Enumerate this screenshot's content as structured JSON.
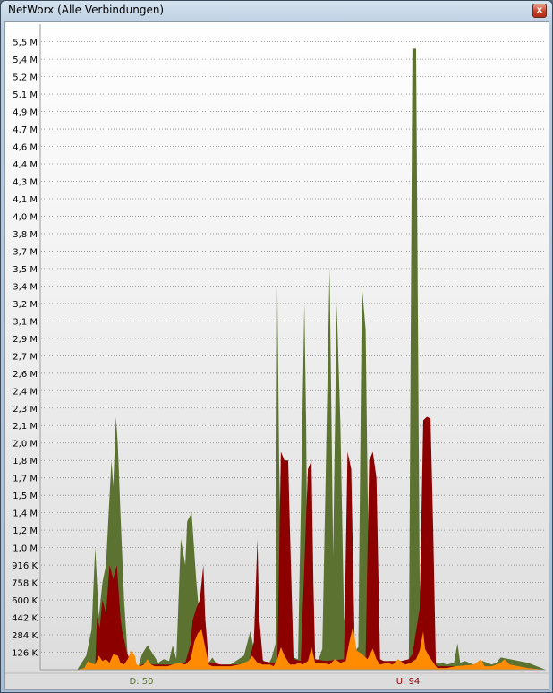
{
  "window": {
    "title": "NetWorx (Alle Verbindungen)",
    "close_label": "x"
  },
  "colors": {
    "download": "#5b7231",
    "upload": "#8c0000",
    "local": "#ff8c00",
    "grid": "#888888"
  },
  "chart_data": {
    "type": "area",
    "title": "",
    "ylabel": "",
    "xlabel": "",
    "y_ticks": [
      "126 K",
      "284 K",
      "442 K",
      "600 K",
      "758 K",
      "916 K",
      "1,0 M",
      "1,2 M",
      "1,4 M",
      "1,5 M",
      "1,7 M",
      "1,8 M",
      "2,0 M",
      "2,1 M",
      "2,3 M",
      "2,4 M",
      "2,6 M",
      "2,7 M",
      "2,9 M",
      "3,1 M",
      "3,2 M",
      "3,4 M",
      "3,5 M",
      "3,7 M",
      "3,8 M",
      "4,0 M",
      "4,1 M",
      "4,3 M",
      "4,4 M",
      "4,6 M",
      "4,7 M",
      "4,9 M",
      "5,1 M",
      "5,2 M",
      "5,4 M",
      "5,5 M"
    ],
    "ylim_index": [
      0,
      35.7
    ],
    "legend": {
      "download_label": "D: 50",
      "upload_label": "U: 94"
    },
    "series": [
      {
        "name": "D",
        "color_key": "download",
        "points": [
          [
            0,
            0
          ],
          [
            40,
            0
          ],
          [
            50,
            0.8
          ],
          [
            56,
            2.3
          ],
          [
            60,
            7
          ],
          [
            64,
            3
          ],
          [
            68,
            5
          ],
          [
            72,
            6
          ],
          [
            75,
            9
          ],
          [
            78,
            12
          ],
          [
            80,
            10.5
          ],
          [
            83,
            14.5
          ],
          [
            85,
            13
          ],
          [
            88,
            9
          ],
          [
            92,
            4
          ],
          [
            96,
            0.8
          ],
          [
            100,
            0.3
          ],
          [
            108,
            0.2
          ],
          [
            112,
            0.9
          ],
          [
            118,
            1.4
          ],
          [
            124,
            0.9
          ],
          [
            130,
            0.4
          ],
          [
            136,
            0.6
          ],
          [
            142,
            0.5
          ],
          [
            146,
            1.4
          ],
          [
            150,
            0.6
          ],
          [
            155,
            7.5
          ],
          [
            160,
            6
          ],
          [
            162,
            8.5
          ],
          [
            167,
            9
          ],
          [
            172,
            5.2
          ],
          [
            176,
            2.8
          ],
          [
            180,
            0.6
          ],
          [
            186,
            0.4
          ],
          [
            190,
            0.7
          ],
          [
            195,
            0.3
          ],
          [
            210,
            0.3
          ],
          [
            225,
            0.8
          ],
          [
            232,
            2.2
          ],
          [
            236,
            1.2
          ],
          [
            240,
            1.5
          ],
          [
            245,
            0.6
          ],
          [
            252,
            0.3
          ],
          [
            256,
            0.7
          ],
          [
            260,
            1.5
          ],
          [
            262,
            22
          ],
          [
            264,
            12
          ],
          [
            268,
            0.8
          ],
          [
            272,
            0.5
          ],
          [
            280,
            0.7
          ],
          [
            285,
            0.6
          ],
          [
            288,
            9
          ],
          [
            292,
            21
          ],
          [
            294,
            14
          ],
          [
            296,
            1.2
          ],
          [
            300,
            0.4
          ],
          [
            308,
            0.6
          ],
          [
            312,
            1.2
          ],
          [
            316,
            12
          ],
          [
            320,
            23
          ],
          [
            324,
            6.5
          ],
          [
            328,
            21
          ],
          [
            332,
            14
          ],
          [
            336,
            3
          ],
          [
            340,
            1.7
          ],
          [
            345,
            0.9
          ],
          [
            352,
            1.3
          ],
          [
            356,
            22
          ],
          [
            360,
            19.5
          ],
          [
            364,
            3
          ],
          [
            368,
            0.9
          ],
          [
            372,
            0.6
          ],
          [
            380,
            0.5
          ],
          [
            390,
            0.4
          ],
          [
            400,
            0.3
          ],
          [
            408,
            0.5
          ],
          [
            412,
            35.6
          ],
          [
            416,
            35.6
          ],
          [
            420,
            5
          ],
          [
            424,
            0.9
          ],
          [
            430,
            0.5
          ],
          [
            436,
            0.4
          ],
          [
            445,
            0.4
          ],
          [
            450,
            0.3
          ],
          [
            458,
            0.4
          ],
          [
            462,
            1.5
          ],
          [
            465,
            0.4
          ],
          [
            470,
            0.5
          ],
          [
            480,
            0.3
          ],
          [
            490,
            0.5
          ],
          [
            500,
            0.3
          ],
          [
            505,
            0.4
          ],
          [
            510,
            0.7
          ],
          [
            520,
            0.6
          ],
          [
            540,
            0.4
          ],
          [
            560,
            0
          ]
        ]
      },
      {
        "name": "U",
        "color_key": "upload",
        "points": [
          [
            0,
            0
          ],
          [
            40,
            0
          ],
          [
            60,
            0.1
          ],
          [
            62,
            3
          ],
          [
            65,
            2.4
          ],
          [
            68,
            4
          ],
          [
            72,
            3.2
          ],
          [
            76,
            6
          ],
          [
            80,
            5.2
          ],
          [
            84,
            6
          ],
          [
            88,
            3
          ],
          [
            90,
            2.2
          ],
          [
            95,
            1
          ],
          [
            100,
            0.4
          ],
          [
            108,
            0.2
          ],
          [
            112,
            0.3
          ],
          [
            118,
            0.4
          ],
          [
            124,
            0.3
          ],
          [
            130,
            0.3
          ],
          [
            136,
            0.3
          ],
          [
            142,
            0.3
          ],
          [
            150,
            0.3
          ],
          [
            160,
            0.4
          ],
          [
            166,
            1.5
          ],
          [
            168,
            2.8
          ],
          [
            172,
            3.5
          ],
          [
            176,
            4
          ],
          [
            180,
            6
          ],
          [
            182,
            3
          ],
          [
            186,
            0.4
          ],
          [
            190,
            0.4
          ],
          [
            200,
            0.3
          ],
          [
            230,
            0.3
          ],
          [
            236,
            1.6
          ],
          [
            240,
            7.5
          ],
          [
            242,
            3
          ],
          [
            246,
            0.5
          ],
          [
            256,
            0.4
          ],
          [
            262,
            0.4
          ],
          [
            266,
            12.5
          ],
          [
            270,
            12
          ],
          [
            274,
            12
          ],
          [
            276,
            8
          ],
          [
            280,
            0.6
          ],
          [
            288,
            0.5
          ],
          [
            296,
            11.5
          ],
          [
            300,
            12
          ],
          [
            302,
            5
          ],
          [
            304,
            0.6
          ],
          [
            316,
            0.5
          ],
          [
            336,
            0.6
          ],
          [
            340,
            12.5
          ],
          [
            344,
            11.5
          ],
          [
            348,
            1
          ],
          [
            352,
            0.6
          ],
          [
            360,
            0.7
          ],
          [
            364,
            12
          ],
          [
            368,
            12.5
          ],
          [
            372,
            11
          ],
          [
            376,
            0.6
          ],
          [
            380,
            0.5
          ],
          [
            400,
            0.5
          ],
          [
            408,
            0.6
          ],
          [
            412,
            0.9
          ],
          [
            420,
            3.5
          ],
          [
            424,
            14.3
          ],
          [
            428,
            14.5
          ],
          [
            432,
            14.4
          ],
          [
            435,
            8
          ],
          [
            438,
            0.3
          ],
          [
            440,
            0.2
          ],
          [
            450,
            0.2
          ],
          [
            470,
            0.2
          ],
          [
            480,
            0.2
          ],
          [
            490,
            0.2
          ],
          [
            500,
            0.2
          ],
          [
            510,
            0.2
          ],
          [
            540,
            0.1
          ],
          [
            560,
            0
          ]
        ]
      },
      {
        "name": "L",
        "color_key": "local",
        "points": [
          [
            0,
            0
          ],
          [
            40,
            0
          ],
          [
            48,
            0.1
          ],
          [
            52,
            0.5
          ],
          [
            55,
            0.4
          ],
          [
            60,
            0.3
          ],
          [
            64,
            0.8
          ],
          [
            68,
            0.5
          ],
          [
            72,
            0.6
          ],
          [
            76,
            0.4
          ],
          [
            80,
            0.9
          ],
          [
            85,
            0.8
          ],
          [
            88,
            0.4
          ],
          [
            92,
            0.3
          ],
          [
            96,
            0.6
          ],
          [
            100,
            1.1
          ],
          [
            104,
            0.8
          ],
          [
            106,
            0.3
          ],
          [
            110,
            0.2
          ],
          [
            114,
            0.3
          ],
          [
            118,
            0.6
          ],
          [
            122,
            0.3
          ],
          [
            126,
            0.2
          ],
          [
            140,
            0.2
          ],
          [
            146,
            0.3
          ],
          [
            152,
            0.4
          ],
          [
            160,
            0.3
          ],
          [
            166,
            0.6
          ],
          [
            170,
            1.6
          ],
          [
            174,
            2.1
          ],
          [
            178,
            2.3
          ],
          [
            182,
            1.3
          ],
          [
            186,
            0.3
          ],
          [
            190,
            0.2
          ],
          [
            210,
            0.2
          ],
          [
            220,
            0.3
          ],
          [
            230,
            0.5
          ],
          [
            234,
            0.8
          ],
          [
            240,
            0.4
          ],
          [
            246,
            0.3
          ],
          [
            254,
            0.3
          ],
          [
            258,
            0.2
          ],
          [
            262,
            0.6
          ],
          [
            266,
            1.3
          ],
          [
            270,
            0.8
          ],
          [
            276,
            0.3
          ],
          [
            282,
            0.3
          ],
          [
            286,
            0.4
          ],
          [
            290,
            0.3
          ],
          [
            296,
            0.5
          ],
          [
            300,
            1.3
          ],
          [
            304,
            0.4
          ],
          [
            312,
            0.4
          ],
          [
            320,
            0.3
          ],
          [
            326,
            0.6
          ],
          [
            332,
            0.4
          ],
          [
            338,
            0.5
          ],
          [
            342,
            1.6
          ],
          [
            346,
            2.5
          ],
          [
            350,
            1.1
          ],
          [
            356,
            0.9
          ],
          [
            362,
            0.6
          ],
          [
            368,
            1.2
          ],
          [
            372,
            0.6
          ],
          [
            376,
            0.3
          ],
          [
            384,
            0.4
          ],
          [
            390,
            0.3
          ],
          [
            396,
            0.6
          ],
          [
            404,
            0.3
          ],
          [
            410,
            0.4
          ],
          [
            416,
            0.6
          ],
          [
            420,
            1.1
          ],
          [
            424,
            2.2
          ],
          [
            426,
            1.2
          ],
          [
            430,
            0.8
          ],
          [
            434,
            0.5
          ],
          [
            438,
            0.2
          ],
          [
            440,
            0.1
          ],
          [
            450,
            0.1
          ],
          [
            460,
            0.2
          ],
          [
            480,
            0.3
          ],
          [
            488,
            0.6
          ],
          [
            492,
            0.2
          ],
          [
            500,
            0.2
          ],
          [
            510,
            0.4
          ],
          [
            514,
            0.6
          ],
          [
            520,
            0.3
          ],
          [
            540,
            0.1
          ],
          [
            560,
            0
          ]
        ]
      }
    ]
  }
}
